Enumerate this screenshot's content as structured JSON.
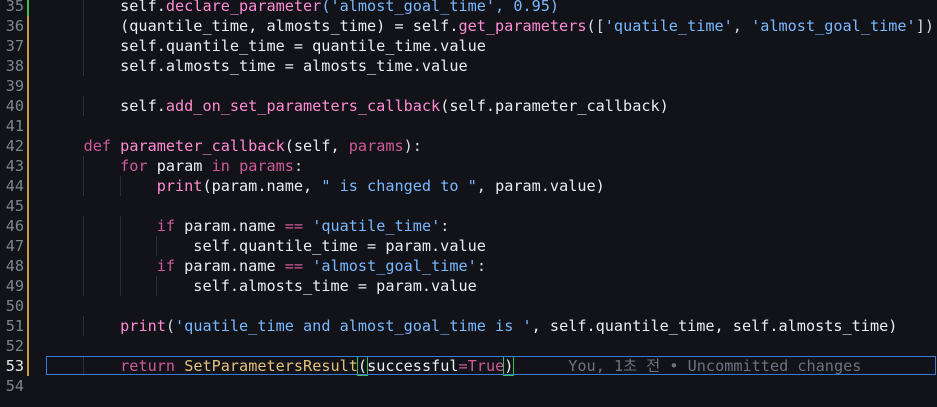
{
  "editor": {
    "lines": [
      {
        "num": "35",
        "mark": "added",
        "tokens": [
          {
            "t": "        self.",
            "c": "self"
          },
          {
            "t": "declare_parameter",
            "c": "fn"
          },
          {
            "t": "('almost_goal_time', 0.95)",
            "c": "str"
          }
        ]
      },
      {
        "num": "36",
        "mark": "modified",
        "tokens": [
          {
            "t": "        (quantile_time, almosts_time) = self.",
            "c": "self"
          },
          {
            "t": "get_parameters",
            "c": "fn"
          },
          {
            "t": "([",
            "c": "op"
          },
          {
            "t": "'quatile_time'",
            "c": "str"
          },
          {
            "t": ", ",
            "c": "op"
          },
          {
            "t": "'almost_goal_time'",
            "c": "str"
          },
          {
            "t": "])",
            "c": "op"
          }
        ]
      },
      {
        "num": "37",
        "mark": "modified",
        "tokens": [
          {
            "t": "        self.quantile_time = quantile_time.value",
            "c": "self"
          }
        ]
      },
      {
        "num": "38",
        "mark": "modified",
        "tokens": [
          {
            "t": "        self.almosts_time = almosts_time.value",
            "c": "self"
          }
        ]
      },
      {
        "num": "39",
        "mark": "modified",
        "tokens": []
      },
      {
        "num": "40",
        "mark": "modified",
        "tokens": [
          {
            "t": "        self.",
            "c": "self"
          },
          {
            "t": "add_on_set_parameters_callback",
            "c": "fn"
          },
          {
            "t": "(self.parameter_callback)",
            "c": "self"
          }
        ]
      },
      {
        "num": "41",
        "mark": "modified",
        "tokens": []
      },
      {
        "num": "42",
        "mark": "modified",
        "tokens": [
          {
            "t": "    ",
            "c": "self"
          },
          {
            "t": "def",
            "c": "kw"
          },
          {
            "t": " ",
            "c": "self"
          },
          {
            "t": "parameter_callback",
            "c": "fn"
          },
          {
            "t": "(self, ",
            "c": "self"
          },
          {
            "t": "params",
            "c": "kw"
          },
          {
            "t": "):",
            "c": "op"
          }
        ]
      },
      {
        "num": "43",
        "mark": "modified",
        "tokens": [
          {
            "t": "        ",
            "c": "self"
          },
          {
            "t": "for",
            "c": "kw"
          },
          {
            "t": " param ",
            "c": "self"
          },
          {
            "t": "in",
            "c": "kw"
          },
          {
            "t": " ",
            "c": "self"
          },
          {
            "t": "params",
            "c": "kw"
          },
          {
            "t": ":",
            "c": "op"
          }
        ]
      },
      {
        "num": "44",
        "mark": "modified",
        "tokens": [
          {
            "t": "            ",
            "c": "self"
          },
          {
            "t": "print",
            "c": "fn"
          },
          {
            "t": "(param.name, ",
            "c": "self"
          },
          {
            "t": "\" is changed to \"",
            "c": "str"
          },
          {
            "t": ", param.value)",
            "c": "self"
          }
        ]
      },
      {
        "num": "45",
        "mark": "modified",
        "tokens": []
      },
      {
        "num": "46",
        "mark": "modified",
        "tokens": [
          {
            "t": "            ",
            "c": "self"
          },
          {
            "t": "if",
            "c": "kw"
          },
          {
            "t": " param.name ",
            "c": "self"
          },
          {
            "t": "==",
            "c": "kw"
          },
          {
            "t": " ",
            "c": "self"
          },
          {
            "t": "'quatile_time'",
            "c": "str"
          },
          {
            "t": ":",
            "c": "op"
          }
        ]
      },
      {
        "num": "47",
        "mark": "modified",
        "tokens": [
          {
            "t": "                self.quantile_time = param.value",
            "c": "self"
          }
        ]
      },
      {
        "num": "48",
        "mark": "modified",
        "tokens": [
          {
            "t": "            ",
            "c": "self"
          },
          {
            "t": "if",
            "c": "kw"
          },
          {
            "t": " param.name ",
            "c": "self"
          },
          {
            "t": "==",
            "c": "kw"
          },
          {
            "t": " ",
            "c": "self"
          },
          {
            "t": "'almost_goal_time'",
            "c": "str"
          },
          {
            "t": ":",
            "c": "op"
          }
        ]
      },
      {
        "num": "49",
        "mark": "modified",
        "tokens": [
          {
            "t": "                self.almosts_time = param.value",
            "c": "self"
          }
        ]
      },
      {
        "num": "50",
        "mark": "modified",
        "tokens": []
      },
      {
        "num": "51",
        "mark": "modified",
        "tokens": [
          {
            "t": "        ",
            "c": "self"
          },
          {
            "t": "print",
            "c": "fn"
          },
          {
            "t": "(",
            "c": "op"
          },
          {
            "t": "'quatile_time and almost_goal_time is '",
            "c": "str"
          },
          {
            "t": ", self.quantile_time, self.almosts_time)",
            "c": "self"
          }
        ]
      },
      {
        "num": "52",
        "mark": "modified",
        "tokens": []
      },
      {
        "num": "53",
        "mark": "modified",
        "current": true,
        "tokens": [
          {
            "t": "        ",
            "c": "self"
          },
          {
            "t": "return",
            "c": "kw"
          },
          {
            "t": " ",
            "c": "self"
          },
          {
            "t": "SetParametersResult",
            "c": "cls"
          },
          {
            "t": "(",
            "c": "bracket-hl"
          },
          {
            "t": "successful",
            "c": "self"
          },
          {
            "t": "=",
            "c": "kw"
          },
          {
            "t": "True",
            "c": "kw"
          },
          {
            "t": ")",
            "c": "bracket-hl"
          }
        ]
      },
      {
        "num": "54",
        "mark": "none",
        "tokens": []
      }
    ],
    "blame_text": "You, 1초 전 • Uncommitted changes"
  }
}
